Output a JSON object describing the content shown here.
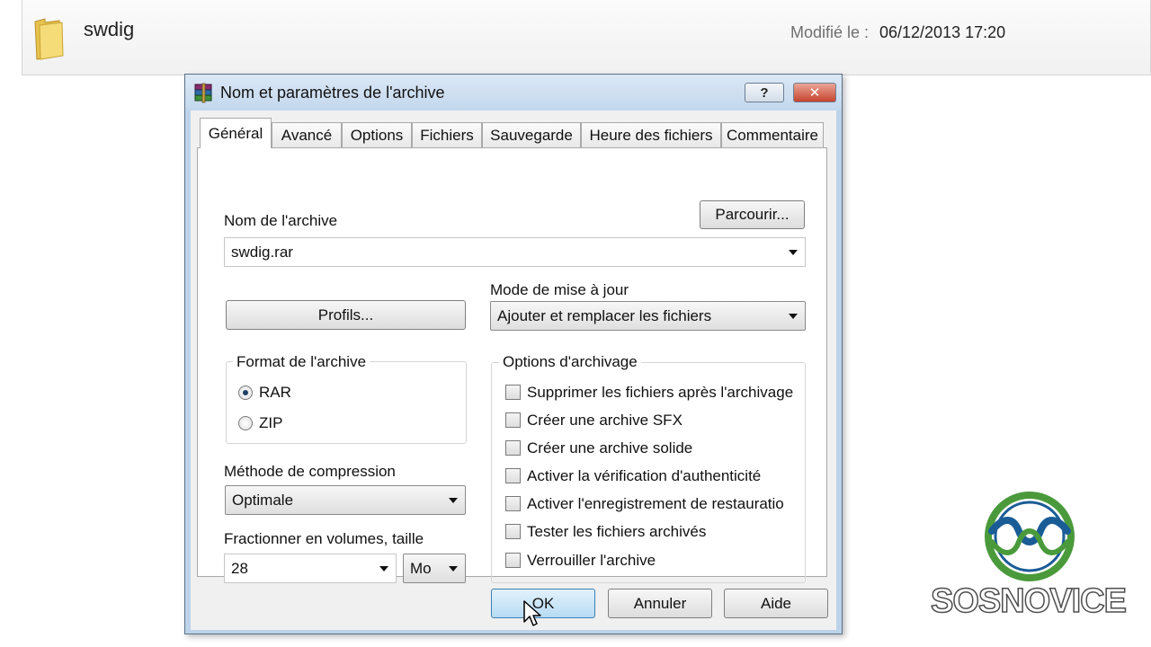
{
  "explorer": {
    "folder_name": "swdig",
    "modified_label": "Modifié le :",
    "modified_value": "06/12/2013 17:20"
  },
  "dialog": {
    "title": "Nom et paramètres de l'archive",
    "help_glyph": "?",
    "close_glyph": "✕",
    "tabs": [
      {
        "label": "Général",
        "active": true
      },
      {
        "label": "Avancé"
      },
      {
        "label": "Options"
      },
      {
        "label": "Fichiers"
      },
      {
        "label": "Sauvegarde"
      },
      {
        "label": "Heure des fichiers"
      },
      {
        "label": "Commentaire"
      }
    ],
    "general": {
      "archive_name_label": "Nom de l'archive",
      "browse_label": "Parcourir...",
      "archive_name_value": "swdig.rar",
      "profiles_label": "Profils...",
      "update_mode_label": "Mode de mise à jour",
      "update_mode_value": "Ajouter et remplacer les fichiers",
      "format_group_label": "Format de l'archive",
      "format_options": [
        {
          "label": "RAR",
          "checked": true
        },
        {
          "label": "ZIP",
          "checked": false
        }
      ],
      "compression_label": "Méthode de compression",
      "compression_value": "Optimale",
      "split_label": "Fractionner en volumes, taille",
      "split_value": "28",
      "split_unit": "Mo",
      "archiving_options_label": "Options d'archivage",
      "archiving_options": [
        {
          "label": "Supprimer les fichiers après l'archivage",
          "checked": false
        },
        {
          "label": "Créer une archive SFX",
          "checked": false
        },
        {
          "label": "Créer une archive solide",
          "checked": false
        },
        {
          "label": "Activer la vérification d'authenticité",
          "checked": false
        },
        {
          "label": "Activer l'enregistrement de restauratio",
          "checked": false
        },
        {
          "label": "Tester les fichiers archivés",
          "checked": false
        },
        {
          "label": "Verrouiller l'archive",
          "checked": false
        }
      ]
    },
    "buttons": {
      "ok": "OK",
      "cancel": "Annuler",
      "help": "Aide"
    }
  },
  "logo": {
    "text": "SOSNOVICE"
  },
  "colors": {
    "dialog_frame": "#bcd3ea",
    "close_button": "#c7442f",
    "ok_button": "#b7dbf4",
    "logo_ring_blue": "#1a5c96",
    "logo_ring_green": "#4a9a3c"
  }
}
